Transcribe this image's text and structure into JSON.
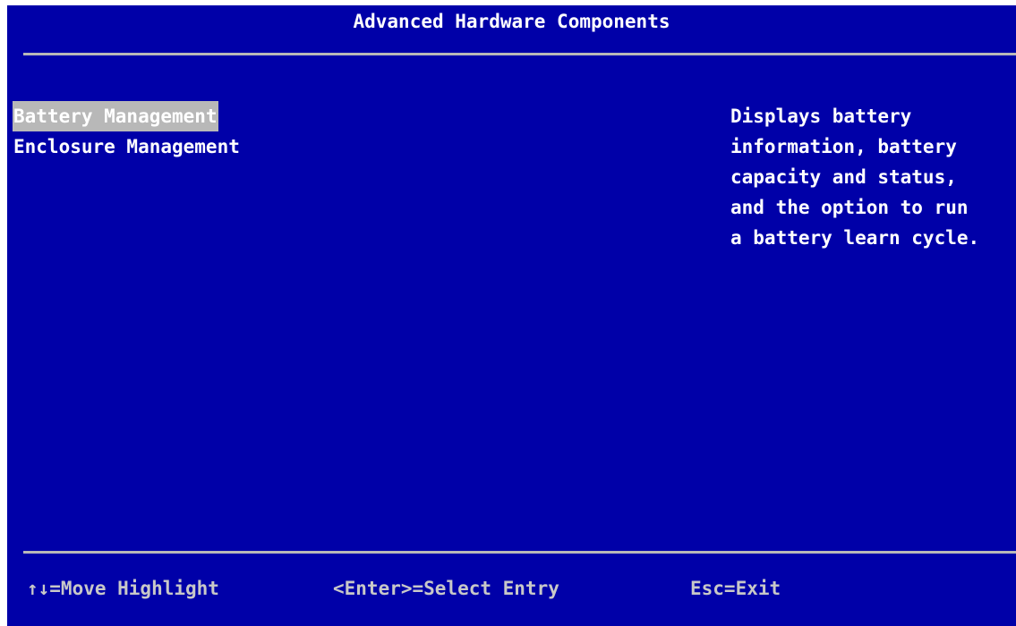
{
  "header": {
    "title": "Advanced Hardware Components"
  },
  "menu": {
    "items": [
      {
        "label": "Battery Management",
        "selected": true
      },
      {
        "label": "Enclosure Management",
        "selected": false
      }
    ]
  },
  "help": {
    "lines": [
      "Displays battery",
      "information, battery",
      "capacity and status,",
      "and the option to run",
      "a battery learn cycle."
    ]
  },
  "footer": {
    "hints": [
      "↑↓=Move Highlight",
      "<Enter>=Select Entry",
      "Esc=Exit"
    ]
  },
  "colors": {
    "background": "#0000a8",
    "text": "#ffffff",
    "highlight": "#b8b8b8",
    "footer_text": "#c8c8c8"
  }
}
